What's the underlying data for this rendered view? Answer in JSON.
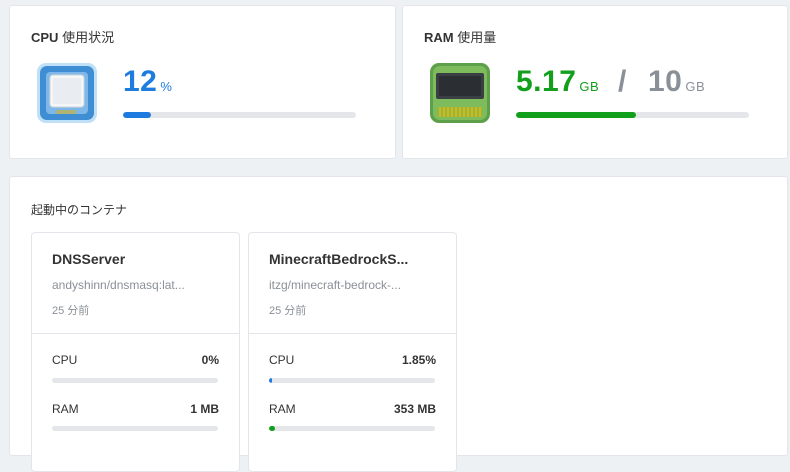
{
  "cpu": {
    "title_latin": "CPU",
    "title_ja": "使用状況",
    "value": "12",
    "unit": "%",
    "percent": 12,
    "icon": "cpu-chip-icon",
    "color": "#1e7be0"
  },
  "ram": {
    "title_latin": "RAM",
    "title_ja": "使用量",
    "used": "5.17",
    "used_unit": "GB",
    "separator": "/",
    "total": "10",
    "total_unit": "GB",
    "used_fraction": 0.517,
    "icon": "ram-module-icon",
    "color": "#129f1c"
  },
  "containers": {
    "title": "起動中のコンテナ",
    "items": [
      {
        "name": "DNSServer",
        "image": "andyshinn/dnsmasq:lat...",
        "age": "25 分前",
        "cpu_label": "CPU",
        "cpu_value": "0%",
        "cpu_fraction": 0,
        "ram_label": "RAM",
        "ram_value": "1 MB",
        "ram_fraction": 0
      },
      {
        "name": "MinecraftBedrockS...",
        "image": "itzg/minecraft-bedrock-...",
        "age": "25 分前",
        "cpu_label": "CPU",
        "cpu_value": "1.85%",
        "cpu_fraction": 0.0185,
        "ram_label": "RAM",
        "ram_value": "353 MB",
        "ram_fraction": 0.035
      }
    ]
  }
}
